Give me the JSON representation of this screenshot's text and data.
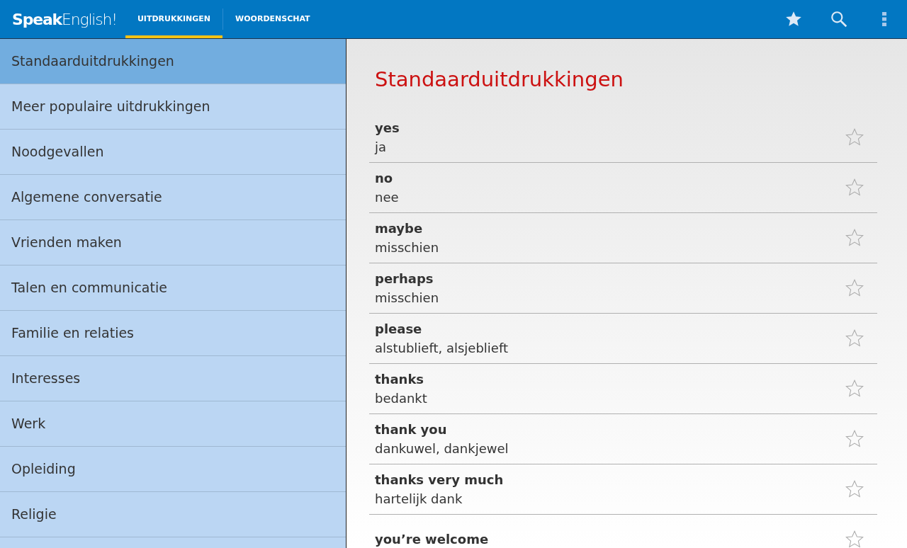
{
  "app_bar": {
    "logo": "**Speak**English!",
    "tabs": [
      {
        "label": "UITDRUKKINGEN",
        "selected": true
      },
      {
        "label": "WOORDENSCHAT",
        "selected": false
      }
    ]
  },
  "sidebar": {
    "items": [
      {
        "label": "Standaarduitdrukkingen",
        "selected": true
      },
      {
        "label": "Meer populaire uitdrukkingen",
        "selected": false
      },
      {
        "label": "Noodgevallen",
        "selected": false
      },
      {
        "label": "Algemene conversatie",
        "selected": false
      },
      {
        "label": "Vrienden maken",
        "selected": false
      },
      {
        "label": "Talen en communicatie",
        "selected": false
      },
      {
        "label": "Familie en relaties",
        "selected": false
      },
      {
        "label": "Interesses",
        "selected": false
      },
      {
        "label": "Werk",
        "selected": false
      },
      {
        "label": "Opleiding",
        "selected": false
      },
      {
        "label": "Religie",
        "selected": false
      }
    ]
  },
  "content": {
    "title": "Standaarduitdrukkingen",
    "phrases": [
      {
        "english": "yes",
        "translation": "ja",
        "starred": false
      },
      {
        "english": "no",
        "translation": "nee",
        "starred": false
      },
      {
        "english": "maybe",
        "translation": "misschien",
        "starred": false
      },
      {
        "english": "perhaps",
        "translation": "misschien",
        "starred": false
      },
      {
        "english": "please",
        "translation": "alstublieft, alsjeblieft",
        "starred": false
      },
      {
        "english": "thanks",
        "translation": "bedankt",
        "starred": false
      },
      {
        "english": "thank you",
        "translation": "dankuwel, dankjewel",
        "starred": false
      },
      {
        "english": "thanks very much",
        "translation": "hartelijk dank",
        "starred": false
      },
      {
        "english": "you’re welcome",
        "starred": false
      }
    ]
  }
}
